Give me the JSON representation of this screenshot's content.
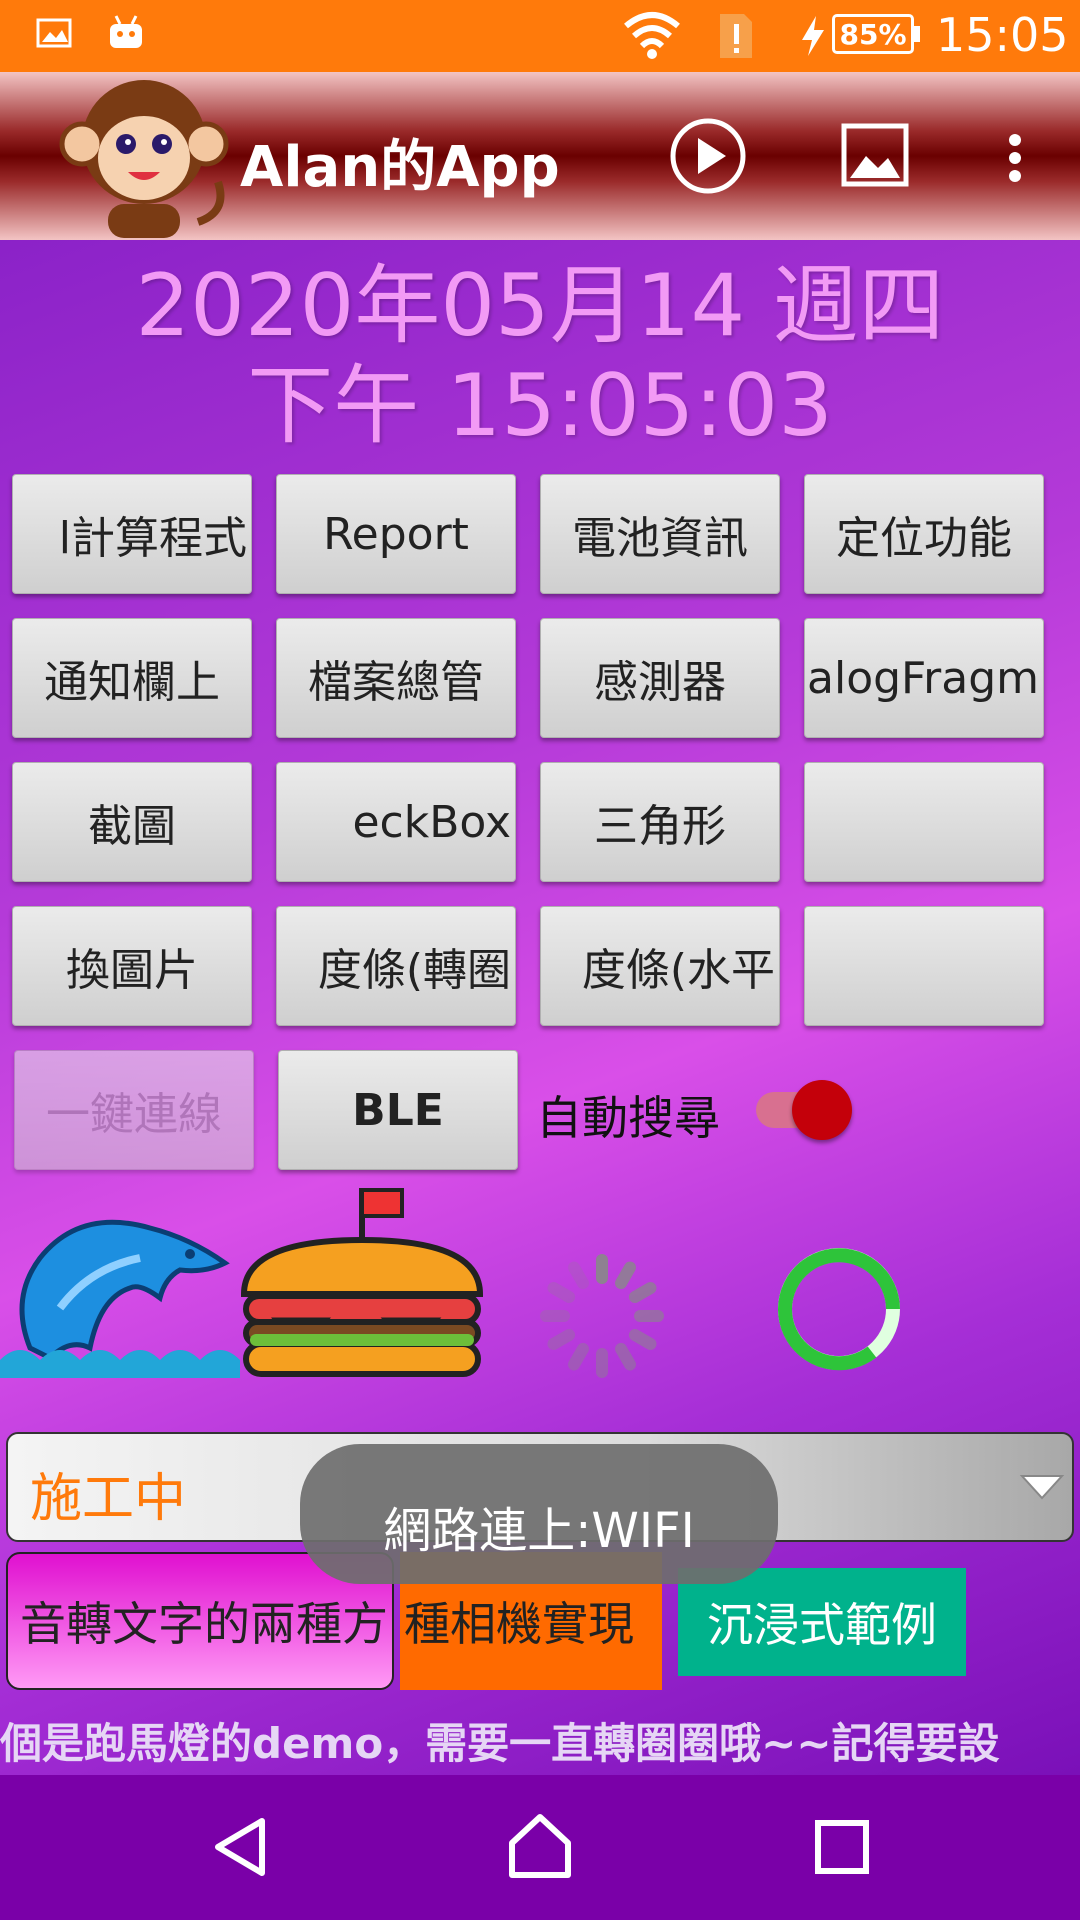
{
  "status_bar": {
    "time": "15:05",
    "battery": "85%",
    "icons": [
      "image-icon",
      "android-icon",
      "wifi-icon",
      "sim-alert-icon",
      "charging-icon",
      "battery-icon"
    ]
  },
  "app_bar": {
    "title": "Alan的App",
    "icons": [
      "monkey-logo",
      "play-icon",
      "gallery-icon",
      "overflow-menu-icon"
    ]
  },
  "datetime": {
    "date": "2020年05月14 週四",
    "time": "下午 15:05:03"
  },
  "buttons": [
    [
      "ML計算程式",
      "Report",
      "電池資訊",
      "定位功能"
    ],
    [
      "通知欄上",
      "檔案總管",
      "感測器",
      "DialogFragment"
    ],
    [
      "截圖",
      "CheckBox",
      "三角形",
      ""
    ],
    [
      "換圖片",
      "進度條(轉圈)",
      "進度條(水平)",
      ""
    ]
  ],
  "button_visible": [
    [
      "l計算程式",
      "Report",
      "電池資訊",
      "定位功能"
    ],
    [
      "通知欄上",
      "檔案總管",
      "感測器",
      "alogFragm"
    ],
    [
      "截圖",
      "eckBox",
      "三角形",
      ""
    ],
    [
      "換圖片",
      "度條(轉圈",
      "度條(水平",
      ""
    ]
  ],
  "row5": {
    "one_key_connect": "一鍵連線",
    "ble": "BLE",
    "auto_search_label": "自動搜尋",
    "auto_search_on": true
  },
  "spinner": {
    "selected": "施工中"
  },
  "toast": "網路連上:WIFI",
  "bottom_buttons": {
    "speech_to_text": "音轉文字的兩種方",
    "camera": "種相機實現",
    "immersive": "沉浸式範例"
  },
  "marquee": "個是跑馬燈的demo，需要一直轉圈圈哦~~記得要設",
  "colors": {
    "status_bar": "#ff7a0b",
    "accent_red": "#c4000a",
    "toast_bg": "#6e6e6e",
    "camera_btn": "#ff6a00",
    "immersive_btn": "#00b28c",
    "date_text": "#f29af5"
  },
  "nav_icons": [
    "back-icon",
    "home-icon",
    "recents-icon"
  ]
}
